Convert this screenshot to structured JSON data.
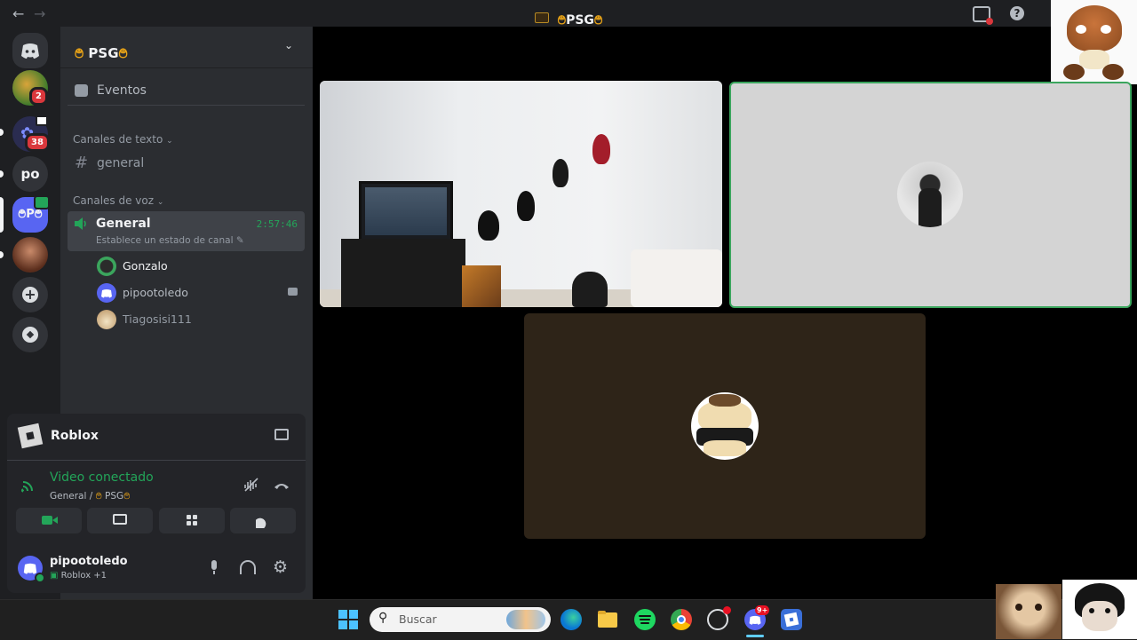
{
  "window": {
    "title_left_glyph": "࿉",
    "title": "PSG",
    "title_right_glyph": "࿉",
    "back_icon": "arrow-left-icon",
    "forward_icon": "arrow-right-icon"
  },
  "rail": {
    "servers": [
      {
        "name": "discord-home",
        "badge": ""
      },
      {
        "name": "server-avatar-1",
        "badge": "2"
      },
      {
        "name": "server-2",
        "badge": "38"
      },
      {
        "name": "server-po",
        "label": "po",
        "badge": ""
      },
      {
        "name": "server-psg",
        "label": "࿉P࿉",
        "badge": ""
      },
      {
        "name": "server-avatar-2",
        "badge": ""
      }
    ],
    "add_icon": "plus-icon",
    "discover_icon": "compass-icon"
  },
  "guild": {
    "glyph_left": "࿉",
    "name": "PSG",
    "glyph_right": "࿉",
    "events_label": "Eventos",
    "text_category": "Canales de texto",
    "text_channel": "general",
    "voice_category": "Canales de voz",
    "voice_channel": "General",
    "voice_timer": "2:57:46",
    "voice_status": "Establece un estado de canal",
    "members": [
      {
        "name": "Gonzalo",
        "color": "#f2f3f5"
      },
      {
        "name": "pipootoledo",
        "color": "#b5bac1"
      },
      {
        "name": "Tiagosisi111",
        "color": "#949ba4"
      }
    ]
  },
  "activity": {
    "game": "Roblox"
  },
  "connection": {
    "status": "Video conectado",
    "location_prefix": "General / ",
    "location_glyph_left": "࿉",
    "location_server": " PSG",
    "location_glyph_right": "࿉"
  },
  "user": {
    "name": "pipootoledo",
    "activity_text": "Roblox +1"
  },
  "taskbar": {
    "search_placeholder": "Buscar",
    "discord_badge": "9+"
  },
  "colors": {
    "accent_green": "#23a559",
    "speaking_border": "#3ba55d",
    "blurple": "#5865f2",
    "badge_red": "#da373c"
  }
}
